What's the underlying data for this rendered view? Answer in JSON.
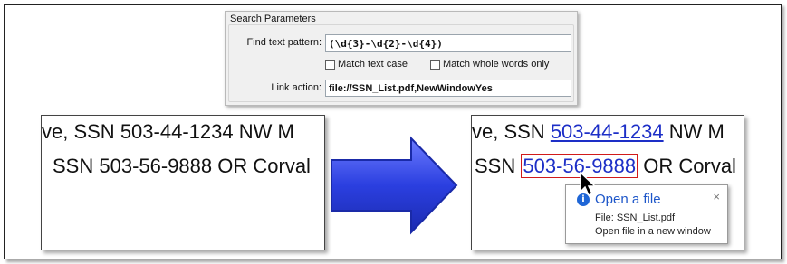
{
  "search_params": {
    "title": "Search Parameters",
    "find_label": "Find text pattern:",
    "find_value": "(\\d{3}-\\d{2}-\\d{4})",
    "match_case_label": "Match text case",
    "match_whole_label": "Match whole words only",
    "link_label": "Link action:",
    "link_value": "file://SSN_List.pdf,NewWindowYes"
  },
  "before": {
    "line1_prefix": "ve,  SSN ",
    "line1_ssn": "503-44-1234",
    "line1_suffix": "  NW M",
    "line2_prefix": "SSN ",
    "line2_ssn": "503-56-9888",
    "line2_suffix": " OR Corval"
  },
  "after": {
    "line1_prefix": "ve,  SSN ",
    "line1_ssn": "503-44-1234",
    "line1_suffix": "  NW M",
    "line2_prefix": "SSN ",
    "line2_ssn": "503-56-9888",
    "line2_suffix": " OR Corval"
  },
  "tooltip": {
    "title": "Open a file",
    "file_line": "File: SSN_List.pdf",
    "action_line": "Open file in a new window",
    "close_glyph": "×",
    "info_glyph": "i"
  },
  "colors": {
    "link": "#1d2fc7",
    "highlight_box": "#d11a1a",
    "arrow_fill": "#2b3fe0"
  }
}
